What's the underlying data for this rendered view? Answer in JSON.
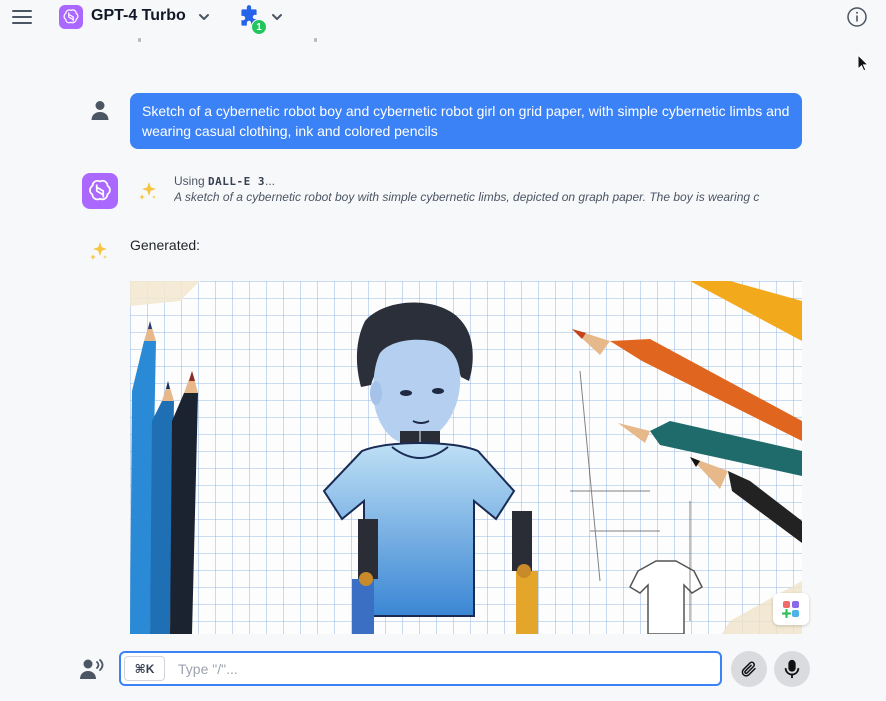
{
  "header": {
    "model_name": "GPT-4 Turbo",
    "plugin_count": "1"
  },
  "conversation": {
    "user_message": "Sketch of a cybernetic robot boy and cybernetic robot girl on grid paper, with simple cybernetic limbs and wearing casual clothing, ink and colored pencils",
    "tool": {
      "using_label": "Using",
      "tool_name": "DALL-E 3",
      "ellipsis": "...",
      "prompt": "A sketch of a cybernetic robot boy with simple cybernetic limbs, depicted on graph paper. The boy is wearing c"
    },
    "generated_label": "Generated:"
  },
  "input": {
    "shortcut": "⌘K",
    "placeholder": "Type \"/\"..."
  },
  "icons": {
    "menu": "hamburger-icon",
    "model": "openai-logo-icon",
    "plugin": "puzzle-piece-icon",
    "info": "info-icon",
    "user": "user-icon",
    "sparkle": "sparkle-icon",
    "voice": "voice-speaking-icon",
    "attach": "paperclip-icon",
    "mic": "microphone-icon",
    "apps": "apps-grid-icon"
  },
  "colors": {
    "accent": "#3b82f6",
    "model_badge": "#ab68ff",
    "plugin_icon": "#2563eb",
    "badge_green": "#22c55e"
  }
}
